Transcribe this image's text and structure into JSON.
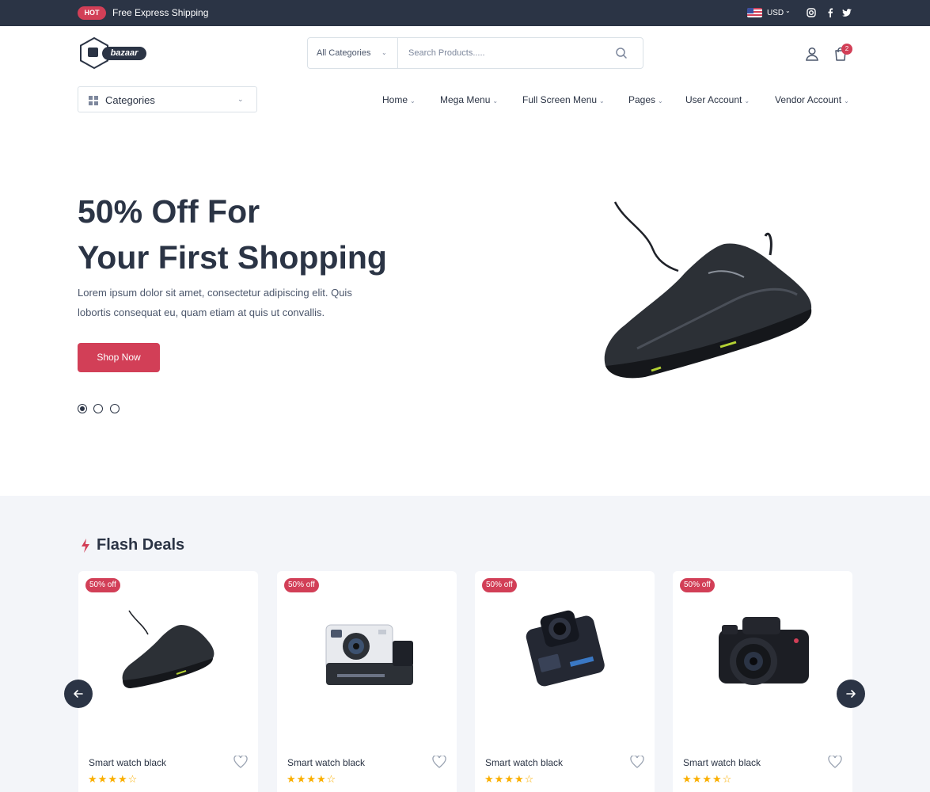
{
  "topbar": {
    "badge": "HOT",
    "promo": "Free Express Shipping",
    "currency": "USD",
    "social_icons": [
      "instagram-icon",
      "facebook-icon",
      "twitter-icon"
    ]
  },
  "header": {
    "logo_text": "bazaar",
    "search": {
      "category": "All Categories",
      "placeholder": "Search Products....."
    },
    "cart_count": "2"
  },
  "nav": {
    "categories_label": "Categories",
    "items": [
      "Home",
      "Mega Menu",
      "Full Screen Menu",
      "Pages",
      "User Account",
      "Vendor Account"
    ]
  },
  "hero": {
    "title_line1": "50% Off For",
    "title_line2": "Your First Shopping",
    "description": "Lorem ipsum dolor sit amet, consectetur adipiscing elit. Quis lobortis consequat eu, quam etiam at quis ut convallis.",
    "button": "Shop Now",
    "slides": 3,
    "active_slide": 1
  },
  "flash_deals": {
    "title": "Flash Deals",
    "products": [
      {
        "discount": "50% off",
        "name": "Smart watch black",
        "rating": 4,
        "image": "sneaker"
      },
      {
        "discount": "50% off",
        "name": "Smart watch black",
        "rating": 4,
        "image": "instant-camera"
      },
      {
        "discount": "50% off",
        "name": "Smart watch black",
        "rating": 4,
        "image": "action-camera"
      },
      {
        "discount": "50% off",
        "name": "Smart watch black",
        "rating": 4,
        "image": "dslr-camera"
      }
    ]
  },
  "colors": {
    "primary": "#d23f57",
    "dark": "#2b3445",
    "section_bg": "#f3f5f9",
    "star": "#faaf00"
  }
}
